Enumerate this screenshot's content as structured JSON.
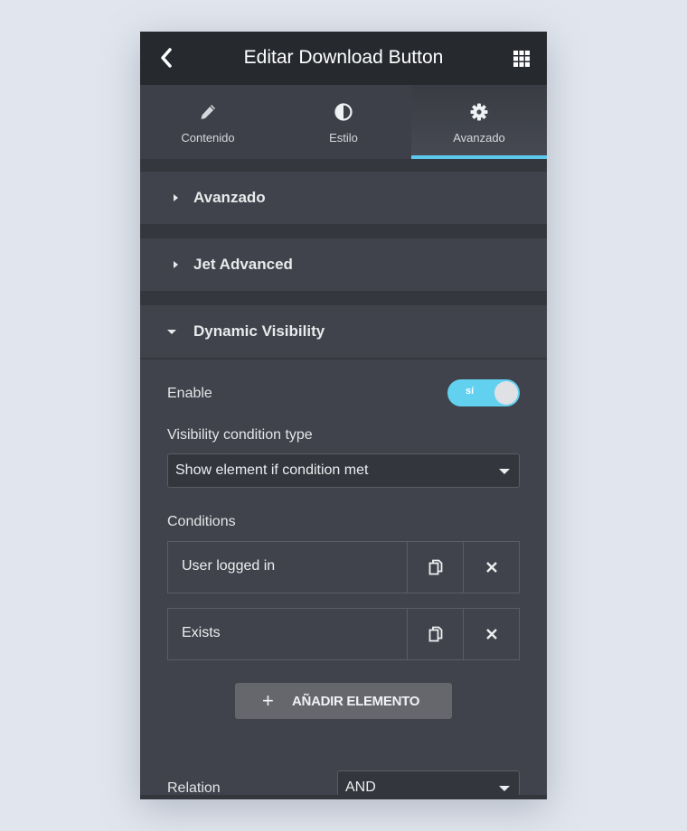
{
  "header": {
    "title": "Editar Download Button",
    "back_icon": "chevron-left-icon",
    "menu_icon": "grid-icon"
  },
  "tabs": [
    {
      "label": "Contenido",
      "icon": "pencil-icon",
      "active": false
    },
    {
      "label": "Estilo",
      "icon": "half-circle-icon",
      "active": false
    },
    {
      "label": "Avanzado",
      "icon": "gear-icon",
      "active": true
    }
  ],
  "sections": [
    {
      "label": "Avanzado",
      "expanded": false
    },
    {
      "label": "Jet Advanced",
      "expanded": false
    },
    {
      "label": "Dynamic Visibility",
      "expanded": true
    }
  ],
  "dynamic_visibility": {
    "enable_label": "Enable",
    "enable_toggle": {
      "on": true,
      "label": "sí"
    },
    "condition_type_label": "Visibility condition type",
    "condition_type_value": "Show element if condition met",
    "conditions_label": "Conditions",
    "conditions": [
      {
        "name": "User logged in"
      },
      {
        "name": "Exists"
      }
    ],
    "add_button": {
      "icon": "+",
      "label": "AÑADIR ELEMENTO"
    },
    "relation_label": "Relation",
    "relation_value": "AND"
  },
  "colors": {
    "accent": "#5bc8ec",
    "panel_bg": "#40434b",
    "topbar_bg": "#26292e",
    "page_bg": "#e1e6ee"
  }
}
